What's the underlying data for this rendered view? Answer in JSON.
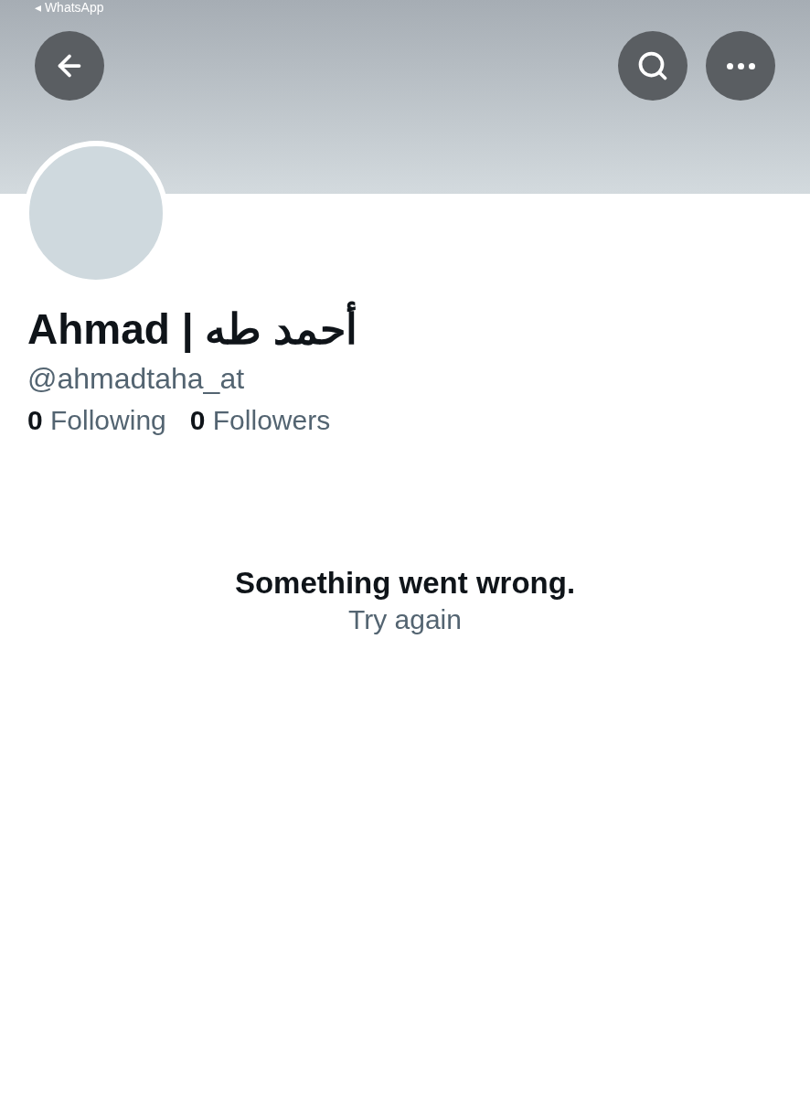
{
  "status_bar": {
    "back_app": "◂ WhatsApp"
  },
  "header": {
    "buttons": [
      {
        "kind": "back"
      },
      {
        "kind": "search"
      },
      {
        "kind": "more"
      }
    ]
  },
  "profile": {
    "name": "Ahmad | أحمد طه",
    "handle": "@ahmadtaha_at",
    "stats": [
      {
        "count": "0",
        "label": "Following"
      },
      {
        "count": "0",
        "label": "Followers"
      }
    ]
  },
  "error": {
    "message": "Something went wrong.",
    "action": "Try again"
  }
}
